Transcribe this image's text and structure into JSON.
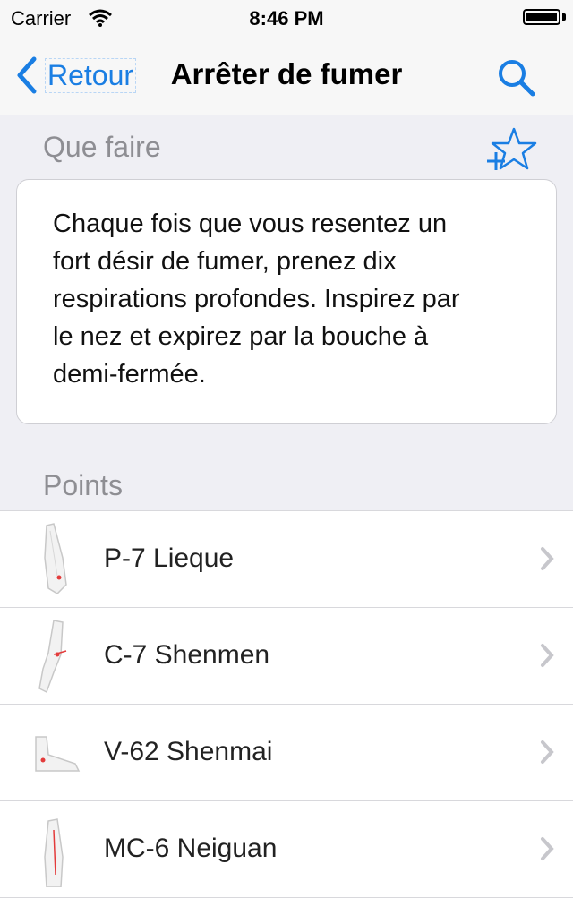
{
  "status_bar": {
    "carrier": "Carrier",
    "time": "8:46 PM"
  },
  "nav": {
    "back_label": "Retour",
    "title": "Arrêter de fumer"
  },
  "section_what": {
    "title": "Que faire"
  },
  "card": {
    "text": "Chaque fois que vous resentez un\nfort désir de fumer, prenez dix\nrespirations profondes. Inspirez par\nle nez et expirez par la bouche à\ndemi-fermée."
  },
  "section_points": {
    "title": "Points"
  },
  "points": [
    {
      "label": "P-7 Lieque",
      "icon": "forearm-illustration-icon"
    },
    {
      "label": "C-7 Shenmen",
      "icon": "wrist-illustration-icon"
    },
    {
      "label": "V-62 Shenmai",
      "icon": "foot-illustration-icon"
    },
    {
      "label": "MC-6 Neiguan",
      "icon": "forearm-illustration-icon"
    }
  ],
  "colors": {
    "accent": "#1a7ee3",
    "header_text": "#8e8e93",
    "background": "#efeff4",
    "point_marker": "#e33b3b"
  }
}
